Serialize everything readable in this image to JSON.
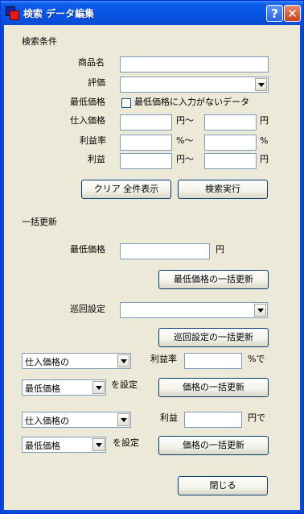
{
  "window": {
    "title": "検索 データ編集"
  },
  "search": {
    "section_title": "検索条件",
    "product_name_label": "商品名",
    "product_name_value": "",
    "rating_label": "評価",
    "rating_value": "",
    "min_price_label": "最低価格",
    "min_price_checkbox_label": "最低価格に入力がないデータ",
    "min_price_checked": false,
    "purchase_price_label": "仕入価格",
    "purchase_price_unit_from": "円～",
    "purchase_price_unit_to": "円",
    "profit_rate_label": "利益率",
    "profit_rate_unit_from": "%～",
    "profit_rate_unit_to": "%",
    "profit_label": "利益",
    "profit_unit_from": "円～",
    "profit_unit_to": "円",
    "clear_button": "クリア 全件表示",
    "search_button": "検索実行"
  },
  "bulk": {
    "section_title": "一括更新",
    "min_price_label": "最低価格",
    "min_price_value": "",
    "min_price_unit": "円",
    "min_price_update_button": "最低価格の一括更新",
    "cycle_label": "巡回設定",
    "cycle_value": "",
    "cycle_update_button": "巡回設定の一括更新",
    "rate_source_select": "仕入価格の",
    "rate_label": "利益率",
    "rate_value": "",
    "rate_suffix": "%で",
    "rate_target_select": "最低価格",
    "rate_set_label": "を設定",
    "rate_update_button": "価格の一括更新",
    "profit_source_select": "仕入価格の",
    "profit_label": "利益",
    "profit_value": "",
    "profit_suffix": "円で",
    "profit_target_select": "最低価格",
    "profit_set_label": "を設定",
    "profit_update_button": "価格の一括更新"
  },
  "footer": {
    "close_button": "閉じる"
  },
  "colors": {
    "titlebar": "#0b5bea",
    "client": "#ece9d8",
    "field_border": "#7f9db9",
    "button_border": "#003c74",
    "close": "#c9421f"
  },
  "icons": {
    "app": "app-icon",
    "help": "help-icon",
    "close": "close-icon"
  }
}
